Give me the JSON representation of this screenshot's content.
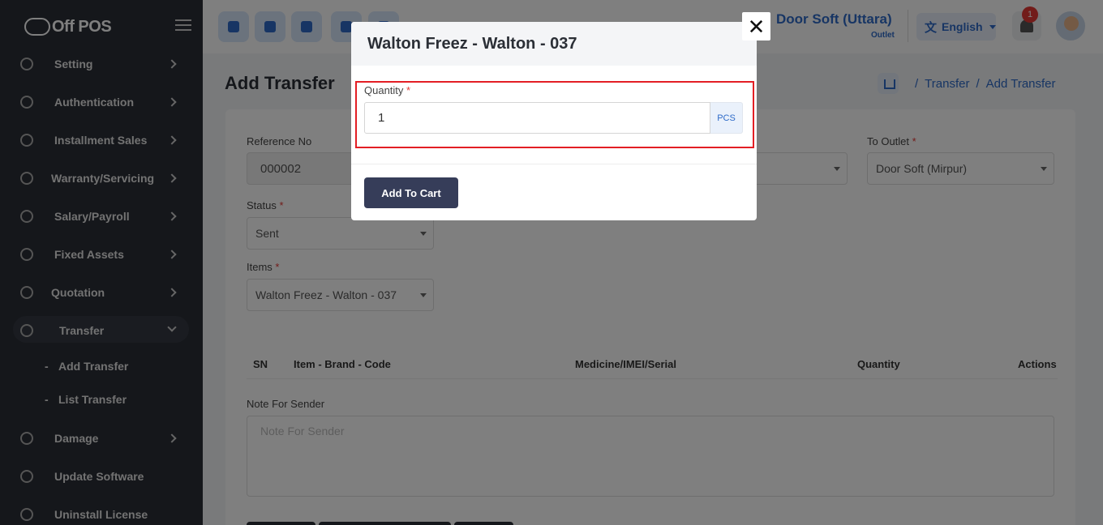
{
  "app": {
    "logo_text": "Off POS"
  },
  "sidebar": {
    "items": [
      {
        "label": "Setting",
        "icon": "settings-icon"
      },
      {
        "label": "Authentication",
        "icon": "shield-icon"
      },
      {
        "label": "Installment Sales",
        "icon": "graduation-cap-icon"
      },
      {
        "label": "Warranty/Servicing",
        "icon": "bell-icon"
      },
      {
        "label": "Salary/Payroll",
        "icon": "coin-icon"
      },
      {
        "label": "Fixed Assets",
        "icon": "star-icon"
      },
      {
        "label": "Quotation",
        "icon": "columns-icon"
      },
      {
        "label": "Transfer",
        "icon": "transfer-icon",
        "expanded": true
      },
      {
        "label": "Damage",
        "icon": "trash-icon"
      },
      {
        "label": "Update Software",
        "icon": "refresh-icon"
      },
      {
        "label": "Uninstall License",
        "icon": "clipboard-icon"
      }
    ],
    "transfer_sub": [
      {
        "label": "Add Transfer"
      },
      {
        "label": "List Transfer"
      }
    ]
  },
  "topbar": {
    "outlet_name": "Door Soft (Uttara)",
    "outlet_sub": "Outlet",
    "language": "English",
    "notification_count": "1",
    "accent": "#2e6bc8"
  },
  "page": {
    "title": "Add Transfer",
    "breadcrumb": [
      "Transfer",
      "Add Transfer"
    ]
  },
  "form": {
    "reference_label": "Reference No",
    "reference_value": "000002",
    "to_outlet_label": "To Outlet",
    "to_outlet_value": "Door Soft (Mirpur)",
    "status_label": "Status",
    "status_value": "Sent",
    "items_label": "Items",
    "items_value": "Walton Freez - Walton - 037",
    "table_headers": [
      "SN",
      "Item - Brand - Code",
      "Medicine/IMEI/Serial",
      "Quantity",
      "Actions"
    ],
    "note_label": "Note For Sender",
    "note_placeholder": "Note For Sender",
    "required_mark": "*"
  },
  "modal": {
    "title": "Walton Freez - Walton - 037",
    "quantity_label": "Quantity",
    "quantity_value": "1",
    "unit": "PCS",
    "add_button": "Add To Cart",
    "close_symbol": "✕",
    "highlight_color": "#e31e24"
  }
}
